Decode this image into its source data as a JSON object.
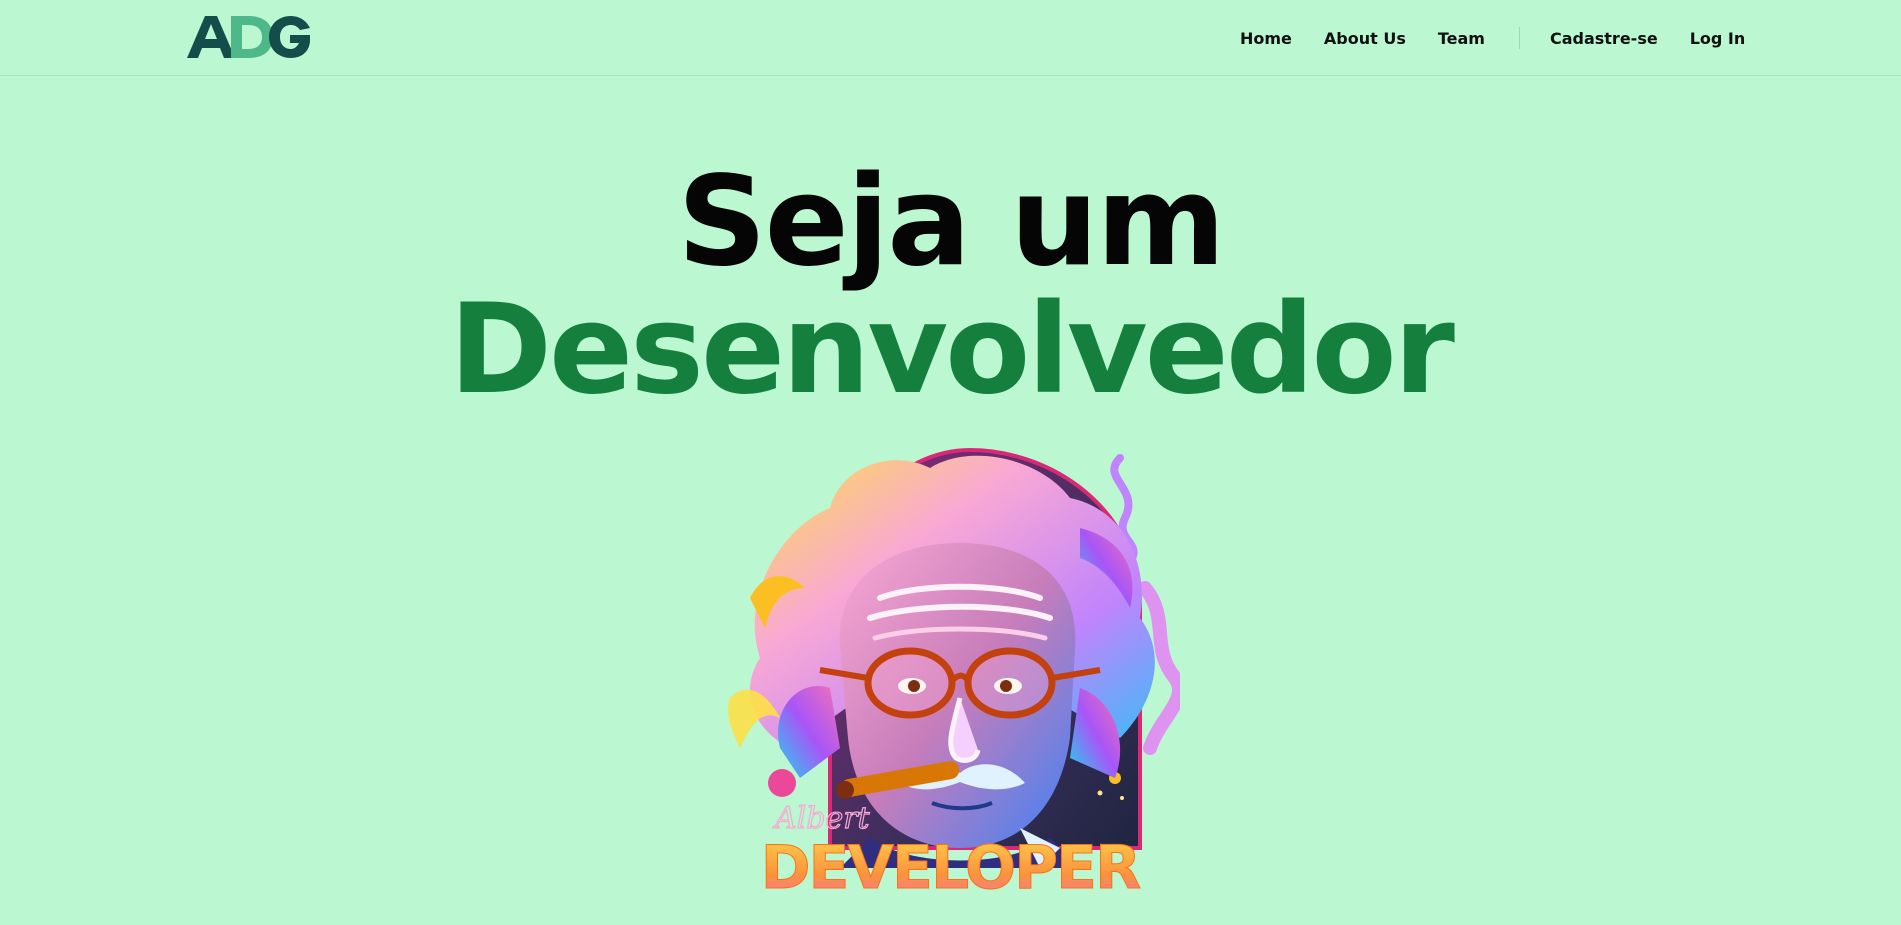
{
  "logo": {
    "text": "ADG",
    "letters": [
      "A",
      "D",
      "G"
    ],
    "colors": {
      "A": "#134e4a",
      "D": "#4ade80",
      "G": "#134e4a"
    }
  },
  "nav": {
    "links": [
      {
        "label": "Home"
      },
      {
        "label": "About Us"
      },
      {
        "label": "Team"
      }
    ],
    "auth": [
      {
        "label": "Cadastre-se"
      },
      {
        "label": "Log In"
      }
    ]
  },
  "hero": {
    "line1": "Seja um",
    "line2": "Desenvolvedor",
    "line2_color": "#15803d"
  },
  "illustration": {
    "subject": "illustrated-portrait-einstein",
    "signature": "Albert",
    "caption": "DEVELOPER"
  },
  "theme": {
    "background": "#bbf7d0",
    "accent": "#15803d"
  }
}
